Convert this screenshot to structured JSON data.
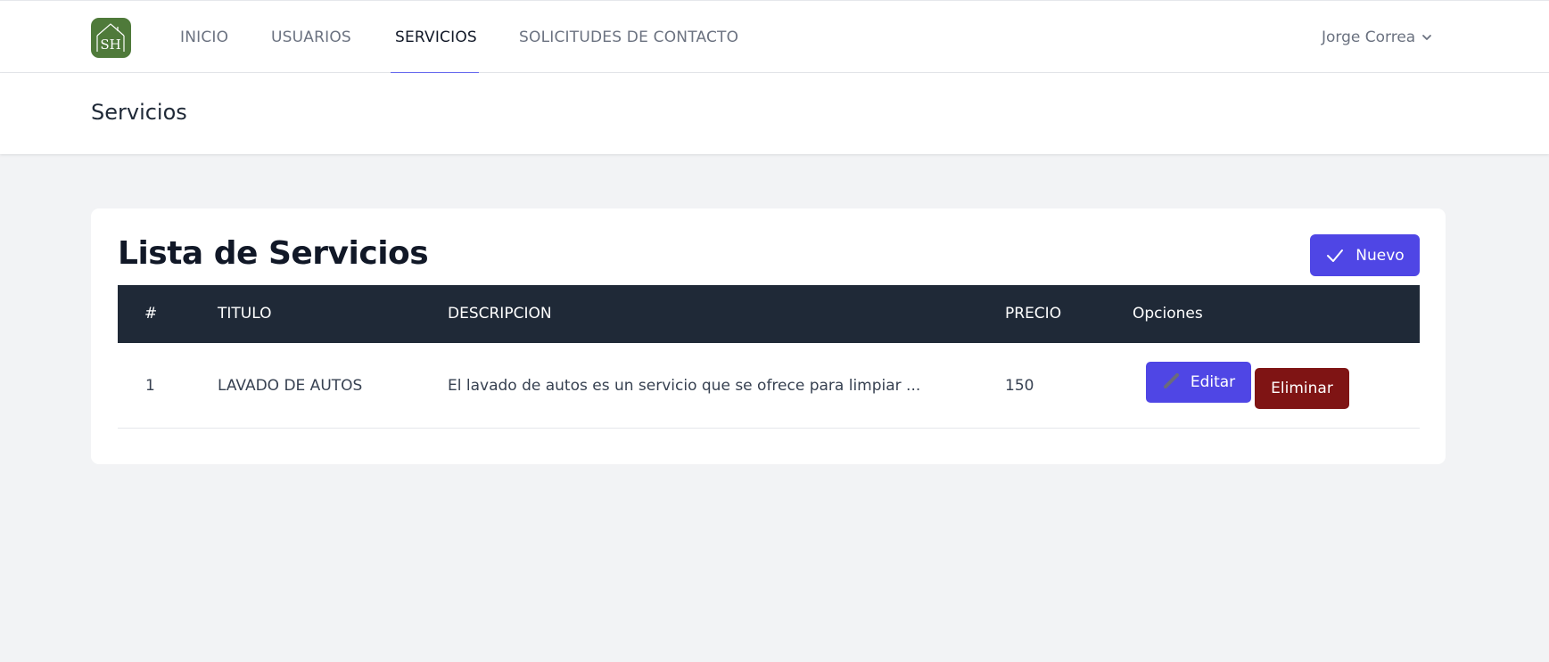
{
  "navbar": {
    "logo_text": "SH",
    "items": [
      {
        "label": "INICIO",
        "active": false
      },
      {
        "label": "USUARIOS",
        "active": false
      },
      {
        "label": "SERVICIOS",
        "active": true
      },
      {
        "label": "SOLICITUDES DE CONTACTO",
        "active": false
      }
    ],
    "user_name": "Jorge Correa",
    "user_icon": "chevron-down-icon"
  },
  "header": {
    "title": "Servicios"
  },
  "card": {
    "title": "Lista de Servicios",
    "new_button": {
      "label": "Nuevo",
      "icon": "check-icon"
    },
    "table": {
      "columns": [
        "#",
        "TITULO",
        "DESCRIPCION",
        "PRECIO",
        "Opciones"
      ],
      "rows": [
        {
          "id": "1",
          "titulo": "LAVADO DE AUTOS",
          "descripcion": "El lavado de autos es un servicio que se ofrece para limpiar ...",
          "precio": "150",
          "edit_label": "Editar",
          "delete_label": "Eliminar"
        }
      ]
    }
  },
  "colors": {
    "accent": "#4f46e5",
    "active_underline": "#6366f1",
    "table_header": "#1f2937",
    "danger": "#7f1414",
    "logo_bg": "#4f7a3a",
    "page_bg": "#f2f3f5"
  }
}
